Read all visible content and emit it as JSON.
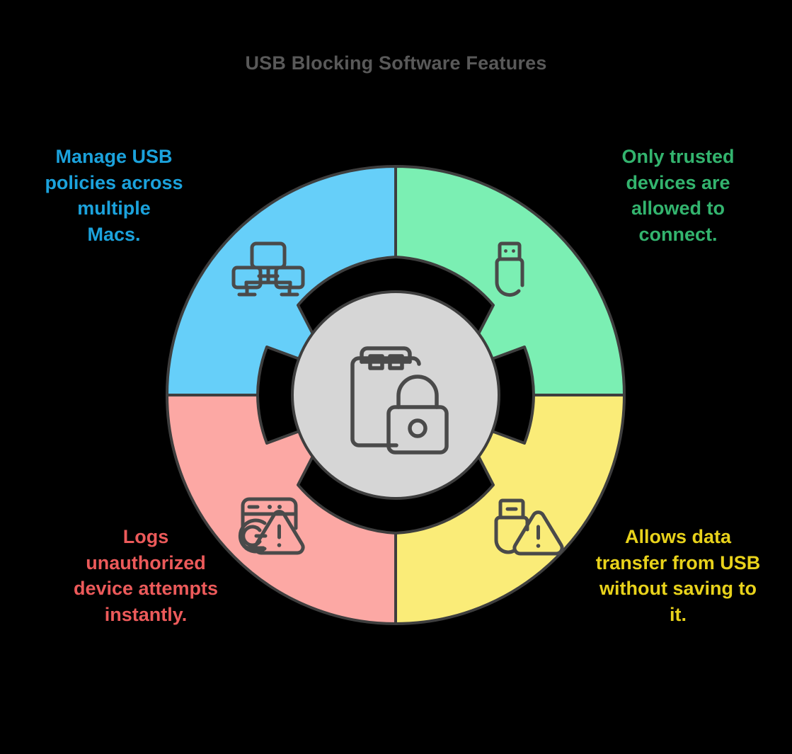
{
  "title": "USB Blocking Software Features",
  "colors": {
    "background": "#000000",
    "title_text": "#595959",
    "stroke": "#3E3E3E",
    "center_fill": "#D6D6D6",
    "segment_blue": "#66CFF9",
    "segment_green": "#7BEFB3",
    "segment_yellow": "#FAEC78",
    "segment_red": "#FCA8A4",
    "text_blue": "#1BA2DC",
    "text_green": "#33B46E",
    "text_yellow": "#E8D21B",
    "text_red": "#EC5A5A"
  },
  "center": {
    "icon": "usb-drive-lock-icon",
    "fill": "#D6D6D6"
  },
  "segments": [
    {
      "id": "top-left",
      "label": "Manage USB\npolicies across\nmultiple\nMacs.",
      "color": "#66CFF9",
      "text_color": "#1BA2DC",
      "icon": "network-computers-icon"
    },
    {
      "id": "top-right",
      "label": "Only trusted\ndevices are\nallowed to\nconnect.",
      "color": "#7BEFB3",
      "text_color": "#33B46E",
      "icon": "usb-flash-drive-icon"
    },
    {
      "id": "bottom-right",
      "label": "Allows data\ntransfer from USB\nwithout saving to\nit.",
      "color": "#FAEC78",
      "text_color": "#E8D21B",
      "icon": "usb-drive-warning-icon"
    },
    {
      "id": "bottom-left",
      "label": "Logs\nunauthorized\ndevice attempts\ninstantly.",
      "color": "#FCA8A4",
      "text_color": "#EC5A5A",
      "icon": "activity-log-warning-icon"
    }
  ],
  "chart_data": {
    "type": "pie",
    "title": "USB Blocking Software Features",
    "categories": [
      "Manage USB policies across multiple Macs.",
      "Only trusted devices are allowed to connect.",
      "Allows data transfer from USB without saving to it.",
      "Logs unauthorized device attempts instantly."
    ],
    "values": [
      25,
      25,
      25,
      25
    ],
    "colors": [
      "#66CFF9",
      "#7BEFB3",
      "#FAEC78",
      "#FCA8A4"
    ],
    "legend": "none",
    "xlabel": "",
    "ylabel": ""
  }
}
